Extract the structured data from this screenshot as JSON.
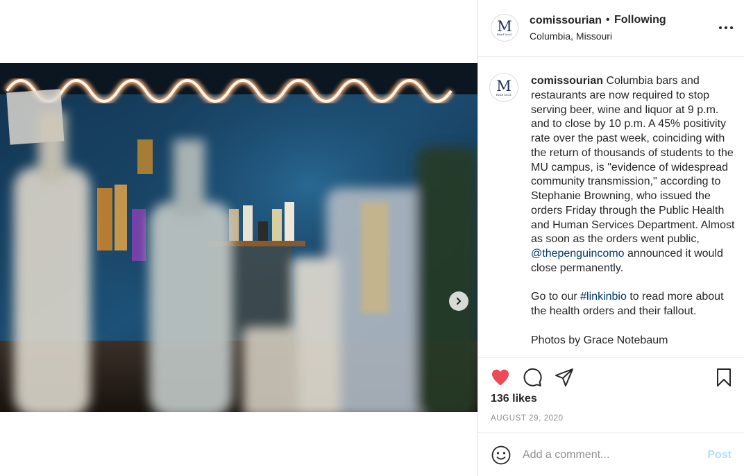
{
  "post": {
    "username": "comissourian",
    "separator": "•",
    "follow_status": "Following",
    "location": "Columbia, Missouri",
    "avatar_monogram": "M",
    "avatar_tagline": "Read local."
  },
  "caption": {
    "username": "comissourian",
    "text_1": " Columbia bars and restaurants are now required to stop serving beer, wine and liquor at 9 p.m. and to close by 10 p.m. A 45% positivity rate over the past week, coinciding with the return of thousands of students to the MU campus, is \"evidence of widespread community transmission,\" according to Stephanie Browning, who issued the orders Friday through the Public Health and Human Services Department. Almost as soon as the orders went public, ",
    "mention": "@thepenguincomo",
    "text_2": " announced it would close permanently.",
    "text_3": "Go to our ",
    "hashtag": "#linkinbio",
    "text_4": " to read more about the health orders and their fallout.",
    "text_5": "Photos by Grace Notebaum"
  },
  "engagement": {
    "likes": "136 likes",
    "date": "AUGUST 29, 2020"
  },
  "comment_box": {
    "placeholder": "Add a comment...",
    "post_label": "Post"
  },
  "icons": {
    "like": "heart-icon",
    "comment": "comment-icon",
    "share": "paper-plane-icon",
    "save": "bookmark-icon",
    "more": "more-options-icon",
    "next": "chevron-right-icon",
    "emoji": "emoji-icon"
  },
  "colors": {
    "like_active": "#ed4956",
    "link": "#00376b",
    "post_disabled": "#b2dffc",
    "muted": "#8e8e8e"
  }
}
